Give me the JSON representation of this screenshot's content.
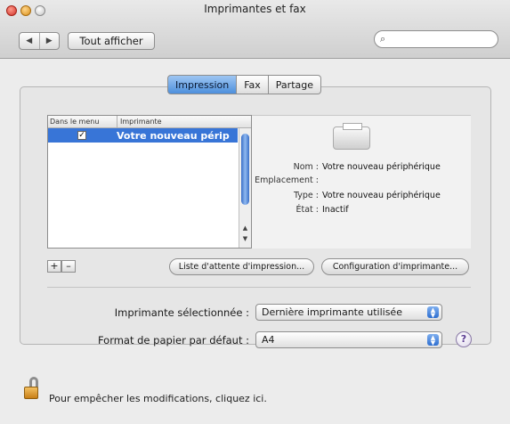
{
  "window": {
    "title": "Imprimantes et fax"
  },
  "toolbar": {
    "back_glyph": "◀",
    "forward_glyph": "▶",
    "show_all_label": "Tout afficher",
    "search_icon": "search-icon",
    "search_value": ""
  },
  "tabs": [
    {
      "label": "Impression",
      "active": true
    },
    {
      "label": "Fax",
      "active": false
    },
    {
      "label": "Partage",
      "active": false
    }
  ],
  "printer_list": {
    "headers": [
      "Dans le menu",
      "Imprimante"
    ],
    "rows": [
      {
        "in_menu": true,
        "check_glyph": "✓",
        "name": "Votre nouveau périp",
        "selected": true
      }
    ]
  },
  "details": {
    "icon": "printer-icon",
    "fields": [
      {
        "label": "Nom :",
        "value": "Votre nouveau périphérique"
      },
      {
        "label": "Emplacement :",
        "value": ""
      },
      {
        "label": "Type :",
        "value": "Votre nouveau périphérique"
      },
      {
        "label": "État :",
        "value": "Inactif"
      }
    ]
  },
  "list_controls": {
    "add_label": "+",
    "remove_label": "–"
  },
  "buttons": {
    "print_queue": "Liste d'attente d'impression...",
    "printer_setup": "Configuration d'imprimante..."
  },
  "selected_printer": {
    "label": "Imprimante sélectionnée :",
    "value": "Dernière imprimante utilisée"
  },
  "paper_size": {
    "label": "Format de papier par défaut :",
    "value": "A4"
  },
  "help": {
    "label": "?"
  },
  "lock": {
    "icon": "padlock-open-icon",
    "text": "Pour empêcher les modifications, cliquez ici."
  },
  "colors": {
    "selection": "#3875d7",
    "tab_active": "#4d8fdc"
  }
}
